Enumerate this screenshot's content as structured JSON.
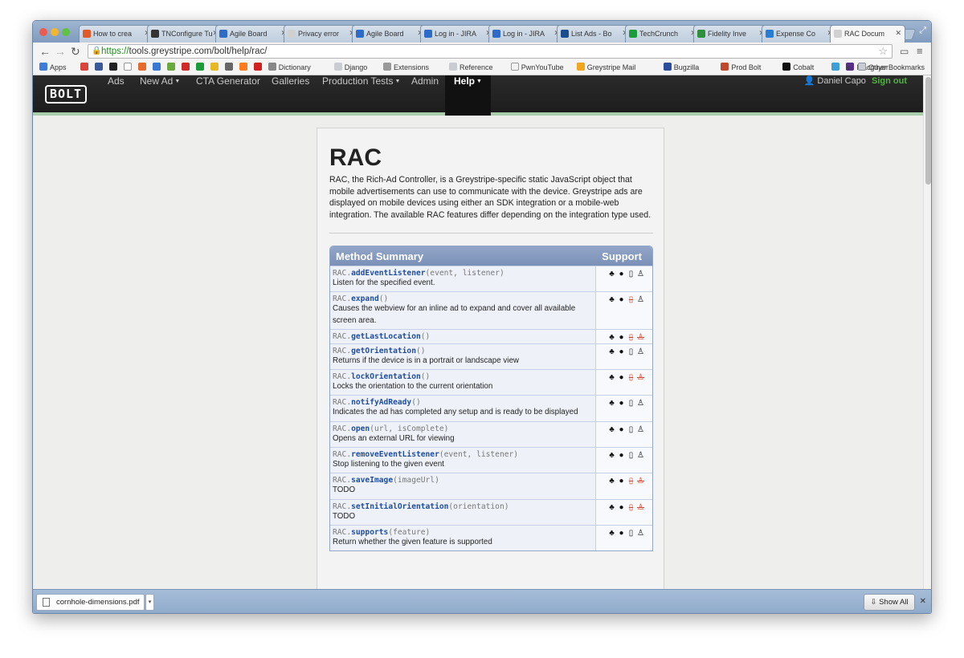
{
  "browser": {
    "tabs": [
      {
        "title": "How to crea",
        "color": "#e05a2a"
      },
      {
        "title": "TNConfigure Tu",
        "color": "#333333"
      },
      {
        "title": "Agile Board",
        "color": "#2e6bc7"
      },
      {
        "title": "Privacy error",
        "color": "#d0d0d0"
      },
      {
        "title": "Agile Board",
        "color": "#2e6bc7"
      },
      {
        "title": "Log in - JIRA",
        "color": "#2e6bc7"
      },
      {
        "title": "Log in - JIRA",
        "color": "#2e6bc7"
      },
      {
        "title": "List Ads - Bo",
        "color": "#1b4d8c"
      },
      {
        "title": "TechCrunch",
        "color": "#1a9c3b"
      },
      {
        "title": "Fidelity Inve",
        "color": "#2f8f3f"
      },
      {
        "title": "Expense Co",
        "color": "#2a7bd4"
      },
      {
        "title": "RAC Docum",
        "color": "#d0d0d0"
      }
    ],
    "active_tab_index": 11,
    "url_scheme": "https://",
    "url_rest": "tools.greystripe.com/bolt/help/rac/",
    "bookmarks": [
      {
        "label": "Apps",
        "color": "#3b7dd8"
      },
      {
        "label": "",
        "color": "#d9453c"
      },
      {
        "label": "",
        "color": "#3b5998"
      },
      {
        "label": "",
        "color": "#222222"
      },
      {
        "label": "",
        "color": "#ffffff"
      },
      {
        "label": "",
        "color": "#e56a2e"
      },
      {
        "label": "",
        "color": "#3a77d2"
      },
      {
        "label": "",
        "color": "#6aa93e"
      },
      {
        "label": "",
        "color": "#d02a2a"
      },
      {
        "label": "",
        "color": "#1a9c3b"
      },
      {
        "label": "",
        "color": "#e8b822"
      },
      {
        "label": "",
        "color": "#666666"
      },
      {
        "label": "",
        "color": "#ff7a1a"
      },
      {
        "label": "",
        "color": "#d21f1f"
      },
      {
        "label": "Dictionary",
        "color": "#888888"
      },
      {
        "label": "Django",
        "color": "#c9cdd3"
      },
      {
        "label": "Extensions",
        "color": "#999999"
      },
      {
        "label": "Reference",
        "color": "#c9cdd3"
      },
      {
        "label": "PwnYouTube",
        "color": "#f2f2f2"
      },
      {
        "label": "Greystripe Mail",
        "color": "#f2a51e"
      },
      {
        "label": "Bugzilla",
        "color": "#2a4d9c"
      },
      {
        "label": "Prod Bolt",
        "color": "#c0492b"
      },
      {
        "label": "Cobalt",
        "color": "#111111"
      },
      {
        "label": "",
        "color": "#3c9fd8"
      },
      {
        "label": "Macguyer",
        "color": "#552d8a"
      }
    ],
    "other_bookmarks": "Other Bookmarks",
    "chevron": "»"
  },
  "app": {
    "logo": "BOLT",
    "nav": [
      {
        "label": "Ads",
        "dropdown": false
      },
      {
        "label": "New Ad",
        "dropdown": true
      },
      {
        "label": "CTA Generator",
        "dropdown": false
      },
      {
        "label": "Galleries",
        "dropdown": false
      },
      {
        "label": "Production Tests",
        "dropdown": true
      },
      {
        "label": "Admin",
        "dropdown": false
      },
      {
        "label": "Help",
        "dropdown": true
      }
    ],
    "user_name": "Daniel Capo",
    "sign_out": "Sign out",
    "accent_color": "#4fb53d"
  },
  "doc": {
    "title": "RAC",
    "intro": "RAC, the Rich-Ad Controller, is a Greystripe-specific static JavaScript object that mobile advertisements can use to communicate with the device. Greystripe ads are displayed on mobile devices using either an SDK integration or a mobile-web integration. The available RAC features differ depending on the integration type used.",
    "table_header_method": "Method Summary",
    "table_header_support": "Support",
    "methods": [
      {
        "prefix": "RAC.",
        "name": "addEventListener",
        "args": "(event, listener)",
        "desc": "Listen for the specified event.",
        "support": [
          true,
          true,
          true,
          true
        ]
      },
      {
        "prefix": "RAC.",
        "name": "expand",
        "args": "()",
        "desc": "Causes the webview for an inline ad to expand and cover all available screen area.",
        "support": [
          true,
          true,
          false,
          true
        ]
      },
      {
        "prefix": "RAC.",
        "name": "getLastLocation",
        "args": "()",
        "desc": "",
        "support": [
          true,
          true,
          false,
          false
        ]
      },
      {
        "prefix": "RAC.",
        "name": "getOrientation",
        "args": "()",
        "desc": "Returns if the device is in a portrait or landscape view",
        "support": [
          true,
          true,
          true,
          true
        ]
      },
      {
        "prefix": "RAC.",
        "name": "lockOrientation",
        "args": "()",
        "desc": "Locks the orientation to the current orientation",
        "support": [
          true,
          true,
          false,
          false
        ]
      },
      {
        "prefix": "RAC.",
        "name": "notifyAdReady",
        "args": "()",
        "desc": "Indicates the ad has completed any setup and is ready to be displayed",
        "support": [
          true,
          true,
          true,
          true
        ]
      },
      {
        "prefix": "RAC.",
        "name": "open",
        "args": "(url, isComplete)",
        "desc": "Opens an external URL for viewing",
        "support": [
          true,
          true,
          true,
          true
        ]
      },
      {
        "prefix": "RAC.",
        "name": "removeEventListener",
        "args": "(event, listener)",
        "desc": "Stop listening to the given event",
        "support": [
          true,
          true,
          true,
          true
        ]
      },
      {
        "prefix": "RAC.",
        "name": "saveImage",
        "args": "(imageUrl)",
        "desc": "TODO",
        "support": [
          true,
          true,
          false,
          false
        ]
      },
      {
        "prefix": "RAC.",
        "name": "setInitialOrientation",
        "args": "(orientation)",
        "desc": "TODO",
        "support": [
          true,
          true,
          false,
          false
        ]
      },
      {
        "prefix": "RAC.",
        "name": "supports",
        "args": "(feature)",
        "desc": "Return whether the given feature is supported",
        "support": [
          true,
          true,
          true,
          true
        ]
      }
    ],
    "support_icons": [
      "android-icon",
      "apple-icon",
      "mobile-web-icon",
      "linux-icon"
    ]
  },
  "downloads": {
    "file": "cornhole-dimensions.pdf",
    "show_all": "Show All"
  }
}
